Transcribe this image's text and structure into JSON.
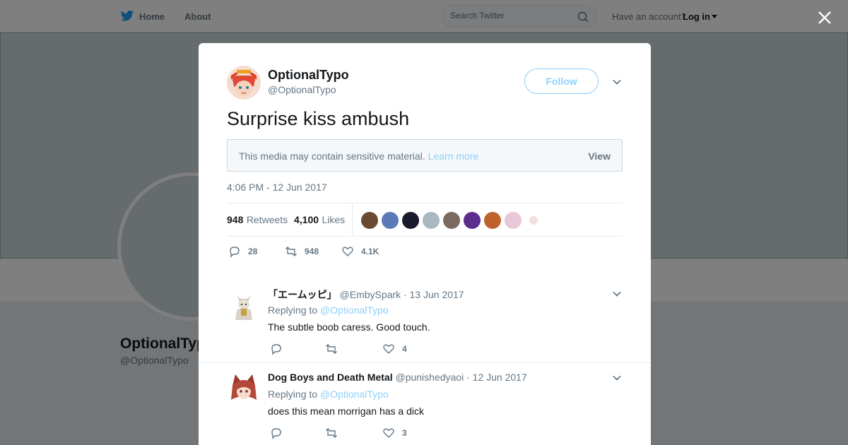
{
  "topbar": {
    "home_label": "Home",
    "about_label": "About",
    "search_placeholder": "Search Twitter",
    "account_prompt": "Have an account?",
    "login_label": "Log in"
  },
  "profile": {
    "name": "OptionalTypo",
    "handle": "@OptionalTypo"
  },
  "tweet": {
    "author_name": "OptionalTypo",
    "author_handle": "@OptionalTypo",
    "follow_label": "Follow",
    "text": "Surprise kiss ambush",
    "sensitive_notice": "This media may contain sensitive material.",
    "learn_more_label": "Learn more",
    "view_label": "View",
    "timestamp": "4:06 PM - 12 Jun 2017",
    "retweets_count": "948",
    "retweets_label": "Retweets",
    "likes_count": "4,100",
    "likes_label": "Likes",
    "actions": {
      "replies": "28",
      "retweets": "948",
      "likes": "4.1K"
    }
  },
  "likers": [
    {
      "icon": "liker-avatar",
      "color": "#6b4a32"
    },
    {
      "icon": "liker-avatar",
      "color": "#5a7ab8"
    },
    {
      "icon": "liker-avatar",
      "color": "#1b1b2e"
    },
    {
      "icon": "liker-avatar",
      "color": "#aab8c2"
    },
    {
      "icon": "liker-avatar",
      "color": "#7a6a60"
    },
    {
      "icon": "liker-avatar",
      "color": "#5b2d8c"
    },
    {
      "icon": "liker-avatar",
      "color": "#c0622e"
    },
    {
      "icon": "liker-avatar",
      "color": "#e8c8d8"
    },
    {
      "icon": "liker-avatar",
      "color": "#f2e0e0"
    }
  ],
  "replies": [
    {
      "name": "「エームッピ」",
      "handle": "@EmbySpark",
      "date": "13 Jun 2017",
      "replying_prefix": "Replying to",
      "replying_to": "@OptionalTypo",
      "text": "The subtle boob caress. Good touch.",
      "reply_count": "",
      "retweet_count": "",
      "like_count": "4"
    },
    {
      "name": "Dog Boys and Death Metal",
      "handle": "@punishedyaoi",
      "date": "12 Jun 2017",
      "replying_prefix": "Replying to",
      "replying_to": "@OptionalTypo",
      "text": "does this mean morrigan has a dick",
      "reply_count": "",
      "retweet_count": "",
      "like_count": "3"
    }
  ],
  "colors": {
    "brand_blue": "#1da1f2",
    "link_light": "#8fd0f8",
    "muted_text": "#657786"
  }
}
